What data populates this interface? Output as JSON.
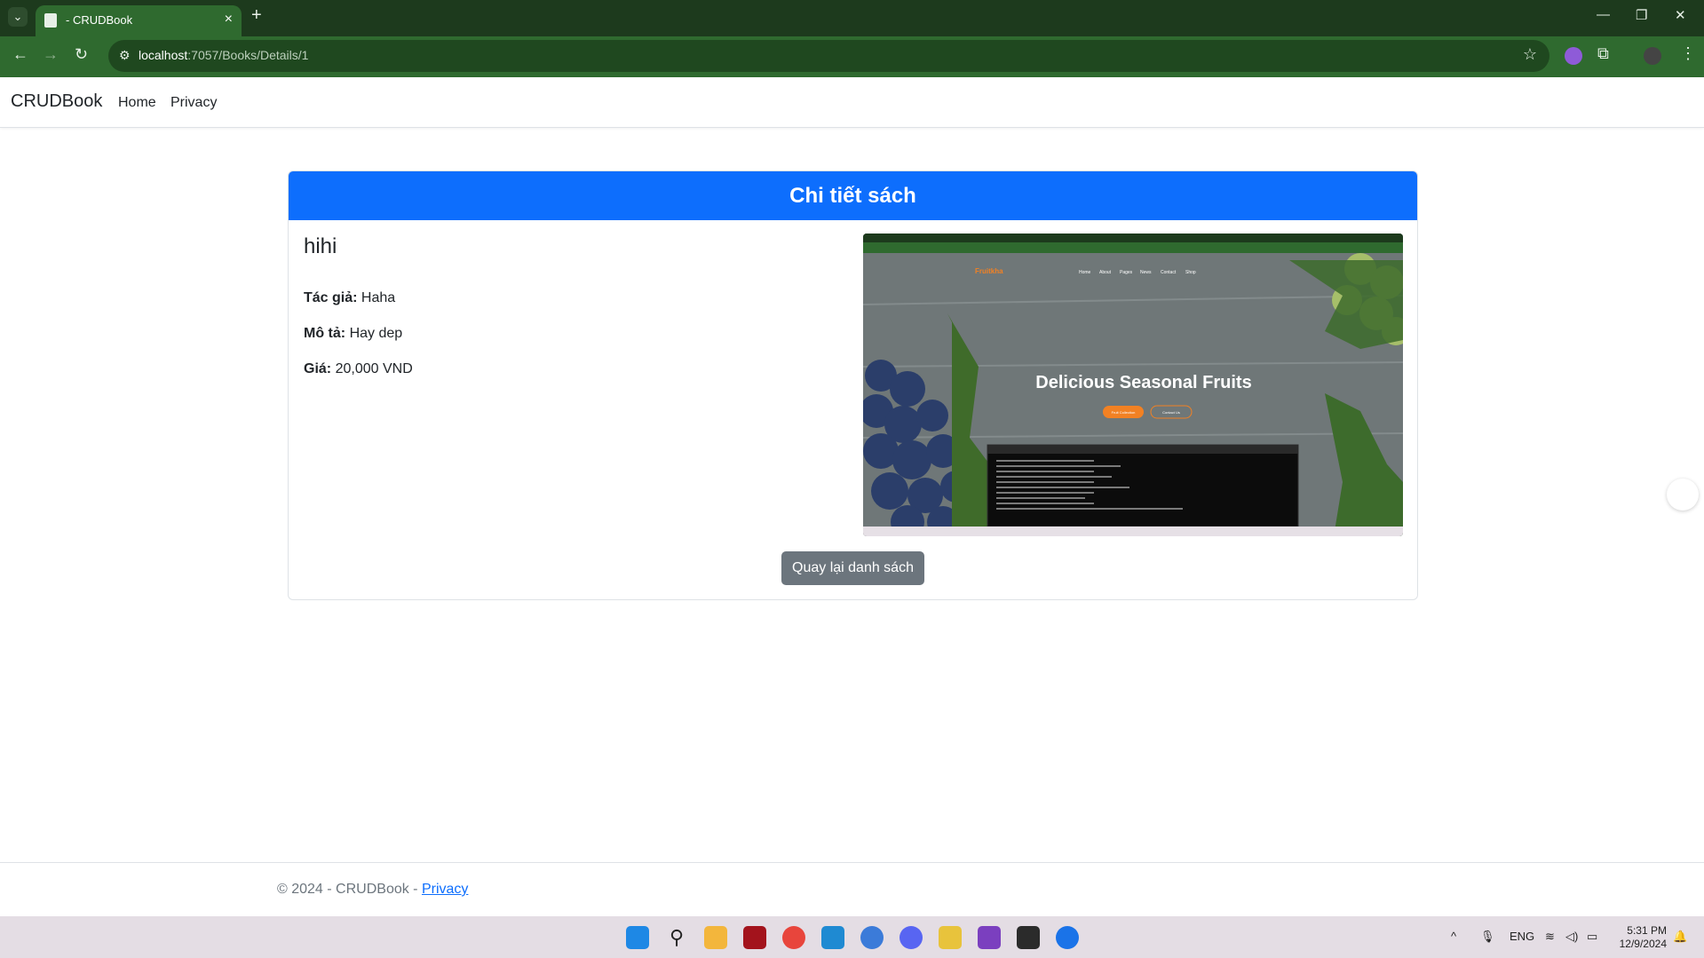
{
  "browser": {
    "tab_title": "- CRUDBook",
    "url_host": "localhost",
    "url_path": ":7057/Books/Details/1"
  },
  "nav": {
    "brand": "CRUDBook",
    "links": [
      "Home",
      "Privacy"
    ]
  },
  "card": {
    "header": "Chi tiết sách",
    "book_title": "hihi",
    "fields": [
      {
        "label": "Tác giả:",
        "value": "Haha"
      },
      {
        "label": "Mô tả:",
        "value": "Hay dep"
      },
      {
        "label": "Giá:",
        "value": "20,000 VND"
      }
    ],
    "cover": {
      "headline": "Delicious Seasonal Fruits",
      "logo": "Fruitkha",
      "menu": [
        "Home",
        "About",
        "Pages",
        "News",
        "Contact",
        "Shop"
      ],
      "btn1": "Fruit Collection",
      "btn2": "Contact Us"
    },
    "back_button": "Quay lại danh sách"
  },
  "footer": {
    "text": "© 2024 - CRUDBook - ",
    "link": "Privacy"
  },
  "taskbar": {
    "lang": "ENG",
    "time": "5:31 PM",
    "date": "12/9/2024"
  },
  "colors": {
    "primary": "#0d6efd",
    "secondary": "#6c757d",
    "chrome_dark": "#1d3a1d",
    "chrome_light": "#2f6a2f"
  }
}
